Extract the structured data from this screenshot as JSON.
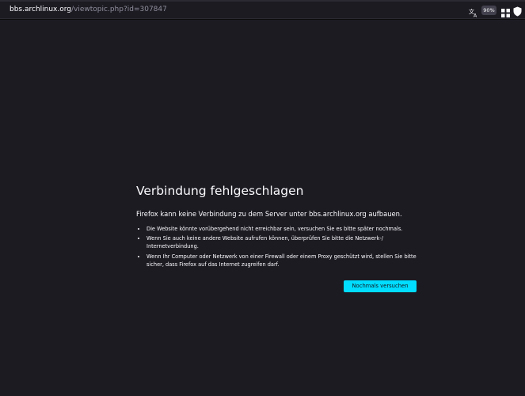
{
  "urlbar": {
    "domain": "bbs.archlinux.org",
    "path": "/viewtopic.php?id=307847",
    "zoom": "90%",
    "icons": [
      "translate-icon",
      "extensions-grid-icon",
      "shield-icon"
    ]
  },
  "error": {
    "title": "Verbindung fehlgeschlagen",
    "intro": "Firefox kann keine Verbindung zu dem Server unter bbs.archlinux.org aufbauen.",
    "items": [
      "Die Website könnte vorübergehend nicht erreichbar sein, versuchen Sie es bitte später nochmals.",
      "Wenn Sie auch keine andere Website aufrufen können, überprüfen Sie bitte die Netzwerk-/ Internetverbindung.",
      "Wenn Ihr Computer oder Netzwerk von einer Firewall oder einem Proxy geschützt wird, stellen Sie bitte sicher, dass Firefox auf das Internet zugreifen darf."
    ],
    "retry_label": "Nochmals versuchen"
  },
  "colors": {
    "page_background": "#1c1b22",
    "toolbar_background": "#2b2a33",
    "text": "#fbfbfe",
    "url_path": "#8f8f9d",
    "button_accent": "#00ddff"
  }
}
